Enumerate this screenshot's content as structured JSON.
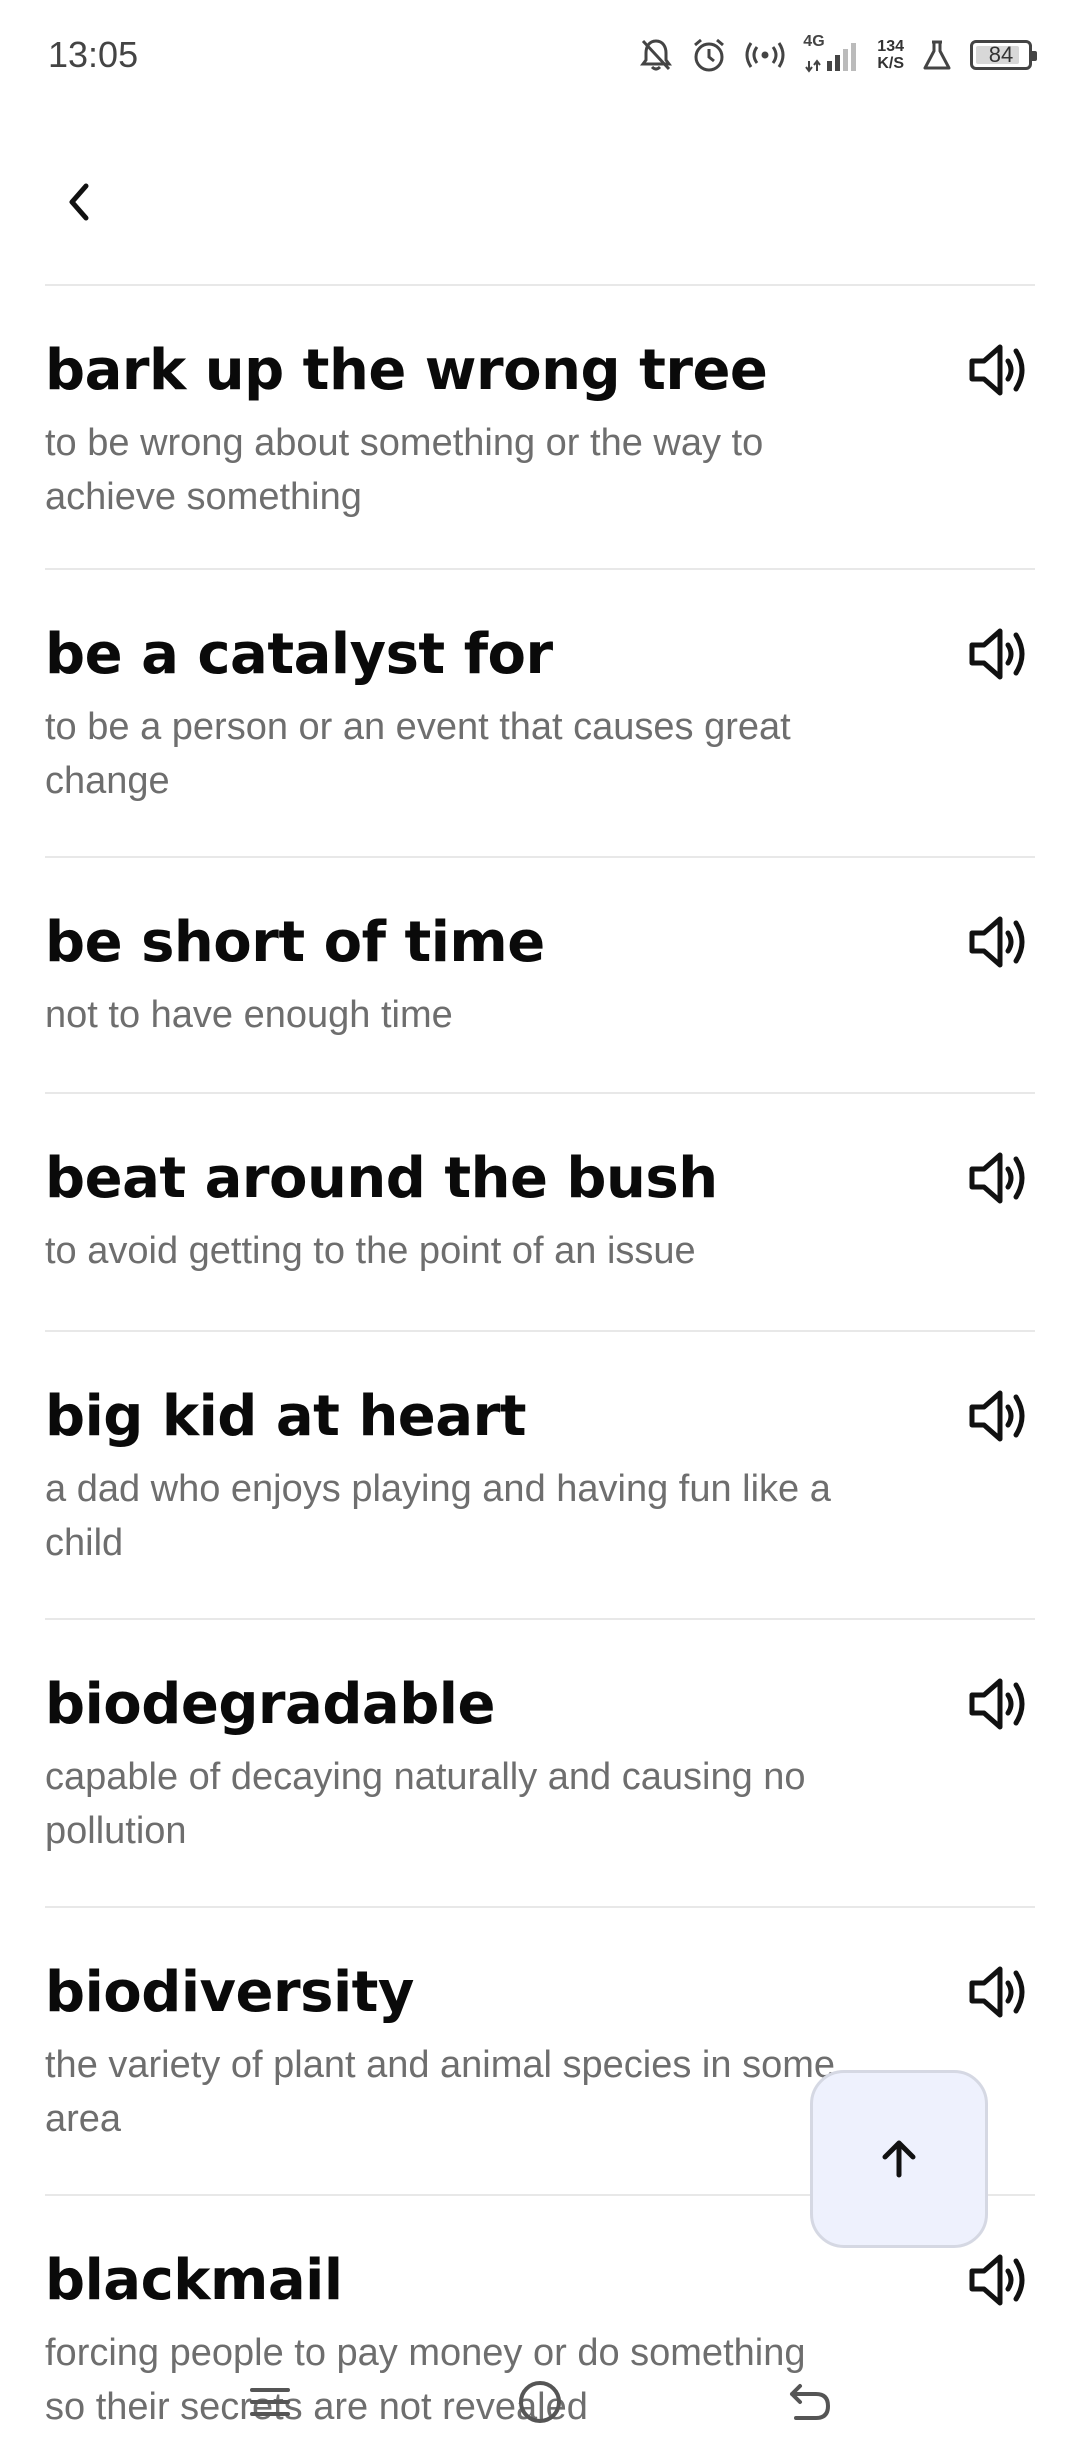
{
  "status_bar": {
    "time": "13:05",
    "network": "4G",
    "speed_value": "134",
    "speed_unit": "K/S",
    "battery": "84"
  },
  "header": {
    "back_icon": "chevron-left-icon"
  },
  "idioms": [
    {
      "title": "bark up the wrong tree",
      "definition": "to be wrong about something or the way to achieve something"
    },
    {
      "title": "be a catalyst for",
      "definition": "to be a person or an event that causes great change"
    },
    {
      "title": "be short of time",
      "definition": "not to have enough time"
    },
    {
      "title": "beat around the bush",
      "definition": "to avoid getting to the point of an issue"
    },
    {
      "title": "big kid at heart",
      "definition": "a dad who enjoys playing and having fun like a child"
    },
    {
      "title": "biodegradable",
      "definition": "capable of decaying naturally and causing no pollution"
    },
    {
      "title": "biodiversity",
      "definition": "the variety of plant and animal species in some area"
    },
    {
      "title": "blackmail",
      "definition": "forcing people to pay money or do something so their secrets are not revealed"
    }
  ],
  "colors": {
    "title": "#0a0a0a",
    "definition": "#6e6e6e",
    "divider": "#e8e8e8",
    "fab_bg": "#eef1fd",
    "fab_border": "#d5d8e3"
  },
  "fab": {
    "icon": "arrow-up-icon"
  },
  "nav_bar": {
    "icons": [
      "menu-icon",
      "home-icon",
      "back-icon"
    ]
  }
}
